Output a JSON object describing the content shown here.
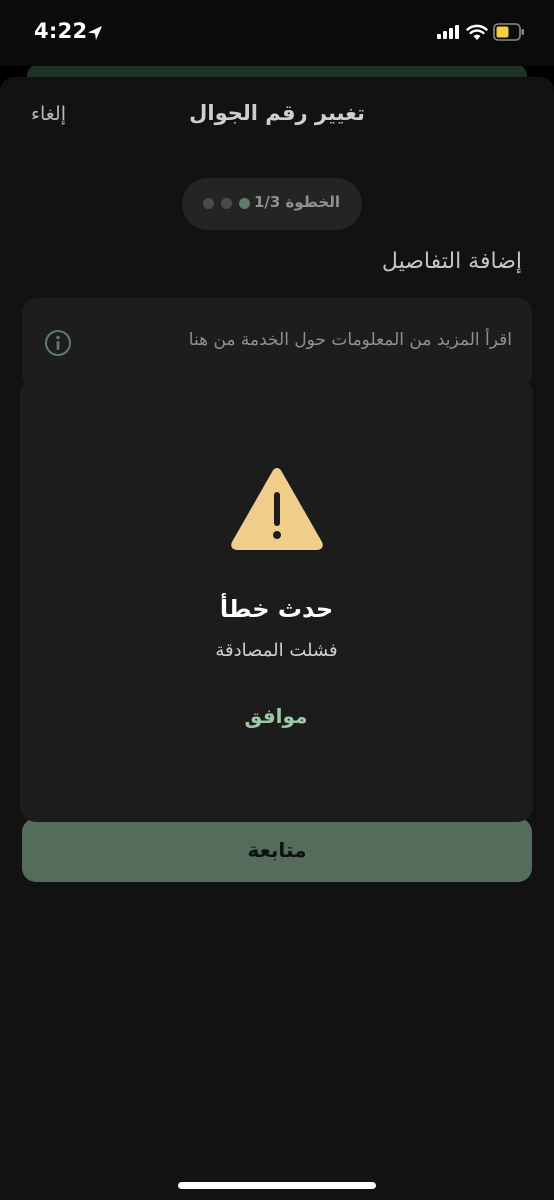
{
  "status_bar": {
    "time": "4:22",
    "icons": [
      "location-arrow-icon",
      "signal-icon",
      "wifi-icon",
      "battery-icon"
    ]
  },
  "header": {
    "title": "تغيير رقم الجوال",
    "cancel_label": "إلغاء"
  },
  "stepper": {
    "label": "الخطوة 1/3",
    "current_step": 1,
    "total_steps": 3
  },
  "section": {
    "title": "إضافة التفاصيل"
  },
  "info_card": {
    "text": "اقرأ المزيد من المعلومات حول الخدمة من هنا",
    "icon": "info-icon"
  },
  "alert": {
    "icon": "warning-icon",
    "title": "حدث خطأ",
    "message": "فشلت المصادقة",
    "ok_label": "موافق"
  },
  "primary_button": {
    "label": "متابعة"
  },
  "colors": {
    "accent": "#9bc9a6",
    "button_bg": "#556b5c",
    "warning": "#f1cd8c",
    "sheet_bg": "#121212",
    "dialog_bg": "#1c1c1c"
  }
}
